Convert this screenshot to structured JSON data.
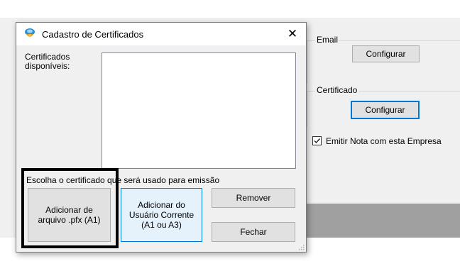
{
  "background": {
    "email_group": {
      "label": "Email",
      "button": "Configurar"
    },
    "cert_group": {
      "label": "Certificado",
      "button": "Configurar"
    },
    "emit_checkbox": {
      "label": "Emitir Nota com esta Empresa",
      "checked": true
    }
  },
  "dialog": {
    "title": "Cadastro de Certificados",
    "close_symbol": "✕",
    "icon": "certificate-app-icon",
    "list_label_line1": "Certificados",
    "list_label_line2": "disponíveis:",
    "hint": "Escolha o certificado que será usado para emissão",
    "buttons": {
      "add_file_line1": "Adicionar de",
      "add_file_line2": "arquivo .pfx (A1)",
      "add_user_line1": "Adicionar do",
      "add_user_line2": "Usuário Corrente",
      "add_user_line3": "(A1 ou A3)",
      "remove": "Remover",
      "close": "Fechar"
    }
  },
  "colors": {
    "accent": "#0078d7",
    "window_bg": "#f0f0f0",
    "button_bg": "#e1e1e1",
    "highlight_outline": "#000000"
  }
}
